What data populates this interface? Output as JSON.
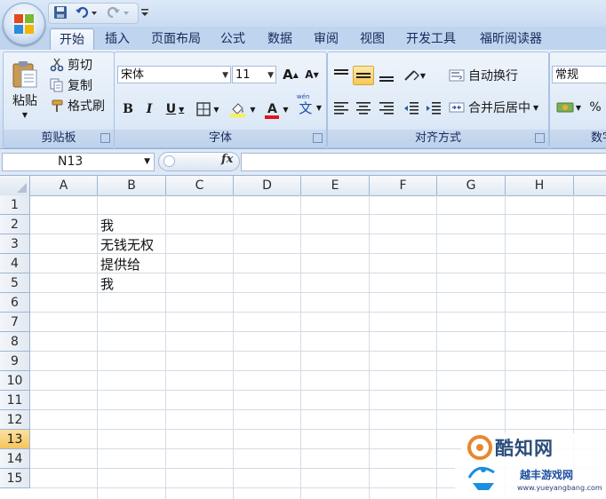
{
  "tabs": [
    "开始",
    "插入",
    "页面布局",
    "公式",
    "数据",
    "审阅",
    "视图",
    "开发工具",
    "福昕阅读器"
  ],
  "active_tab": "开始",
  "clipboard": {
    "paste_label": "粘贴",
    "cut_label": "剪切",
    "copy_label": "复制",
    "format_painter_label": "格式刷",
    "group_label": "剪贴板"
  },
  "font": {
    "font_name": "宋体",
    "font_size": "11",
    "grow_label": "A",
    "shrink_label": "A",
    "bold_label": "B",
    "italic_label": "I",
    "underline_label": "U",
    "font_color_label": "A",
    "phonetic_label": "文",
    "phonetic_top": "wén",
    "group_label": "字体"
  },
  "alignment": {
    "wrap_text_label": "自动换行",
    "merge_center_label": "合并后居中",
    "group_label": "对齐方式"
  },
  "number": {
    "format": "常规",
    "percent_label": "%",
    "group_label": "数字"
  },
  "formula_bar": {
    "name_box": "N13",
    "fx_label": "fx",
    "formula": ""
  },
  "sheet": {
    "columns": [
      "A",
      "B",
      "C",
      "D",
      "E",
      "F",
      "G",
      "H"
    ],
    "rows": [
      "1",
      "2",
      "3",
      "4",
      "5",
      "6",
      "7",
      "8",
      "9",
      "10",
      "11",
      "12",
      "13",
      "14",
      "15"
    ],
    "selected_row": "13",
    "cells": {
      "B2": "我",
      "B3": "无钱无权",
      "B4": "提供给",
      "B5": "我"
    }
  },
  "watermark": {
    "main": "酷知网",
    "sub": "越丰游戏网",
    "url": "www.yueyangbang.com"
  },
  "colors": {
    "ribbon": "#dbe7f6",
    "tab_bar": "#bfd4ee",
    "selected_header": "#f4c55c",
    "highlight_button": "#f7c855"
  }
}
